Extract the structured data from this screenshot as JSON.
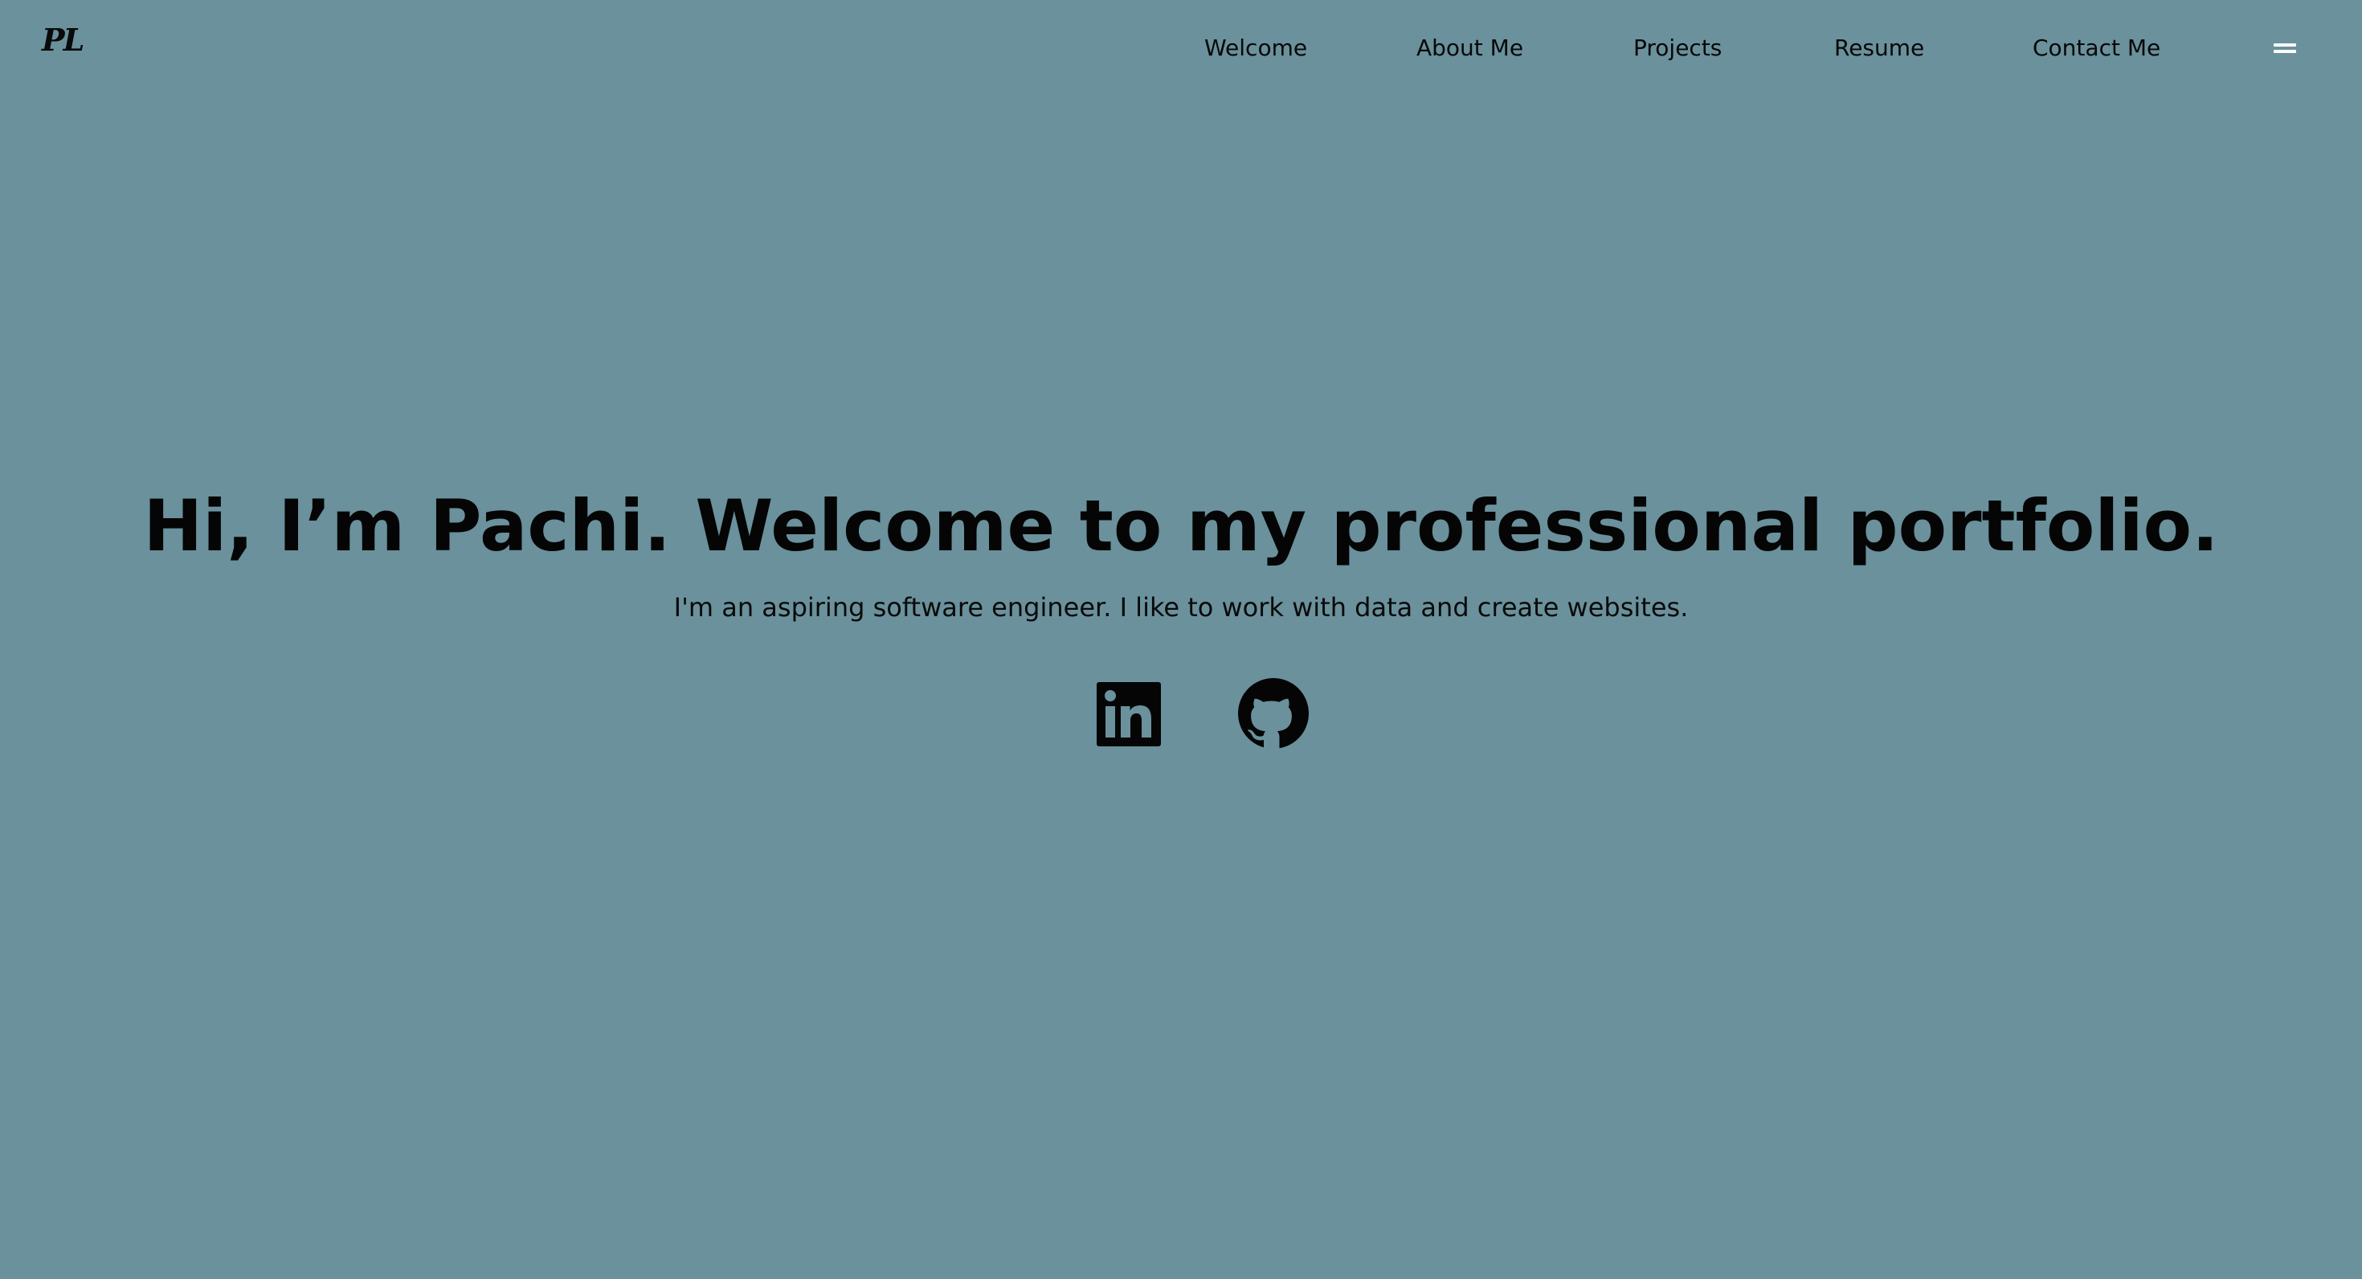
{
  "header": {
    "logo_text": "PL",
    "nav": [
      {
        "label": "Welcome"
      },
      {
        "label": "About Me"
      },
      {
        "label": "Projects"
      },
      {
        "label": "Resume"
      },
      {
        "label": "Contact Me"
      }
    ],
    "menu_icon": "hamburger-menu-icon"
  },
  "hero": {
    "title": "Hi, I’m Pachi. Welcome to my professional portfolio.",
    "subtitle": "I'm an aspiring software engineer. I like to work with data and create websites."
  },
  "socials": [
    {
      "name": "linkedin",
      "icon": "linkedin-icon"
    },
    {
      "name": "github",
      "icon": "github-icon"
    }
  ],
  "colors": {
    "background": "#6a919c",
    "text": "#060606",
    "menu_icon": "#ffffff"
  }
}
